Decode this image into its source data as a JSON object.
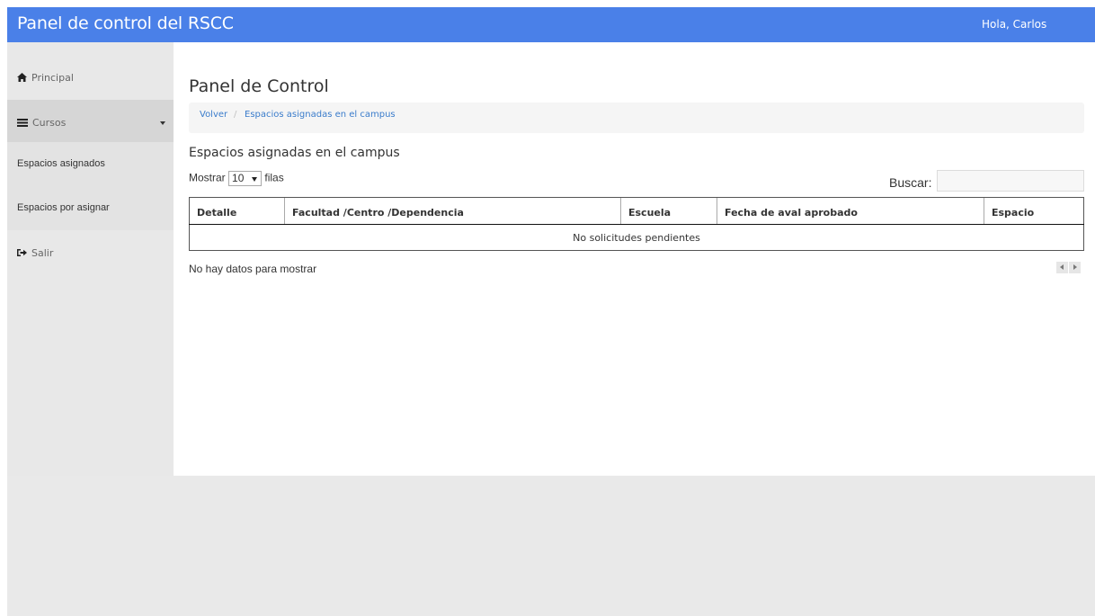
{
  "header": {
    "title": "Panel de control del RSCC",
    "greeting": "Hola, Carlos"
  },
  "sidebar": {
    "items": [
      {
        "label": "Principal",
        "icon": "home-icon"
      },
      {
        "label": "Cursos",
        "icon": "list-icon",
        "expanded": true,
        "children": [
          {
            "label": "Espacios asignados"
          },
          {
            "label": "Espacios por asignar"
          }
        ]
      },
      {
        "label": "Salir",
        "icon": "sign-out-icon"
      }
    ]
  },
  "main": {
    "page_title": "Panel de Control",
    "breadcrumb": {
      "back": "Volver",
      "separator": "/",
      "current": "Espacios asignadas en el campus"
    },
    "section_title": "Espacios asignadas en el campus",
    "length": {
      "prefix": "Mostrar",
      "value": "10",
      "suffix": "filas"
    },
    "search": {
      "label": "Buscar:",
      "value": ""
    },
    "table": {
      "columns": [
        "Detalle",
        "Facultad /Centro /Dependencia",
        "Escuela",
        "Fecha de aval aprobado",
        "Espacio"
      ],
      "empty_message": "No solicitudes pendientes"
    },
    "info": "No hay datos para mostrar"
  },
  "colors": {
    "topbar": "#4a80e8",
    "link": "#3a7ccb",
    "sidebar_bg": "#e8e8e8",
    "active_bg": "#d6d6d6"
  }
}
